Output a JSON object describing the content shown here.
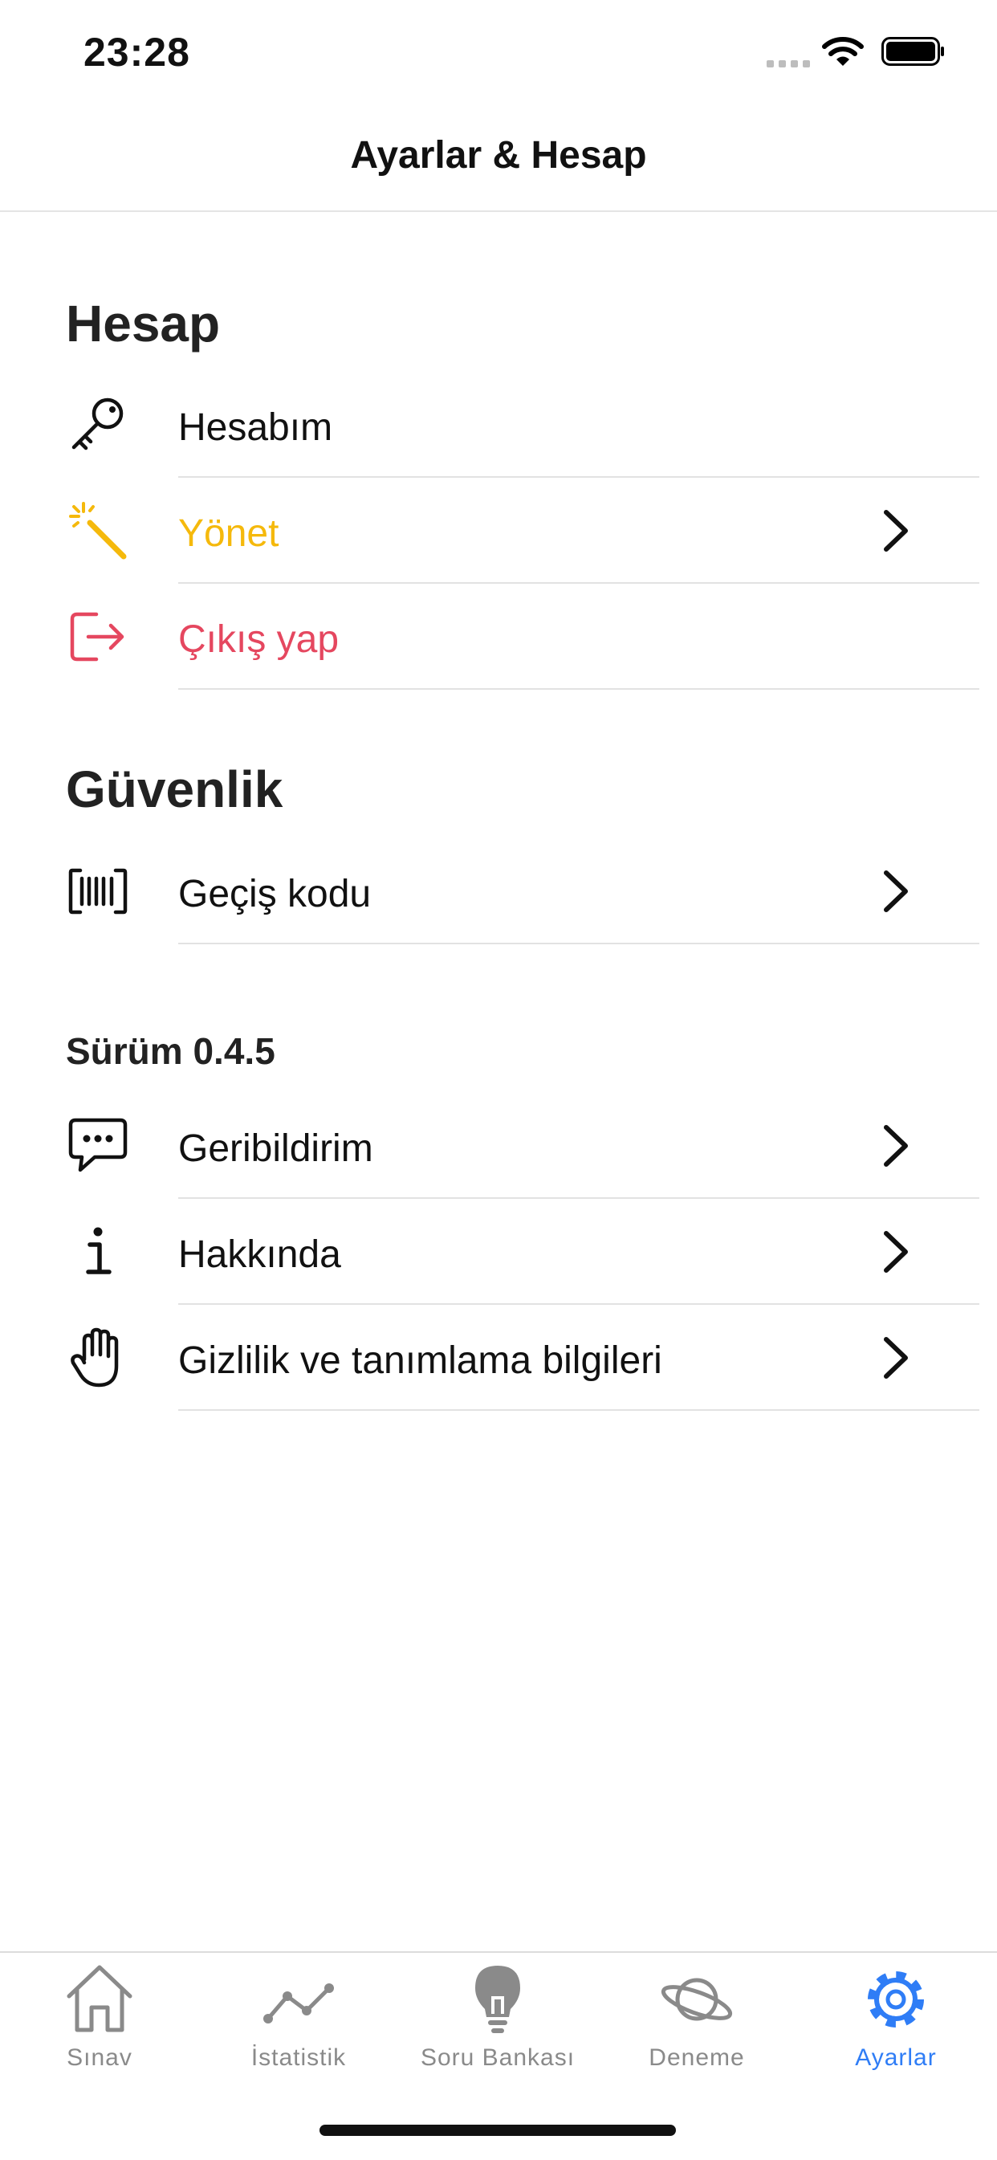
{
  "status_bar": {
    "time": "23:28"
  },
  "nav": {
    "title": "Ayarlar & Hesap"
  },
  "sections": {
    "hesap": {
      "title": "Hesap",
      "items": [
        {
          "label": "Hesabım",
          "icon": "key-icon"
        },
        {
          "label": "Yönet",
          "icon": "magic-wand-icon",
          "color": "#f5b90c"
        },
        {
          "label": "Çıkış yap",
          "icon": "sign-out-icon",
          "color": "#e5475f"
        }
      ]
    },
    "guvenlik": {
      "title": "Güvenlik",
      "items": [
        {
          "label": "Geçiş kodu",
          "icon": "barcode-icon"
        }
      ]
    },
    "surum": {
      "title": "Sürüm 0.4.5",
      "items": [
        {
          "label": "Geribildirim",
          "icon": "chat-icon"
        },
        {
          "label": "Hakkında",
          "icon": "info-icon"
        },
        {
          "label": "Gizlilik ve tanımlama bilgileri",
          "icon": "hand-icon"
        }
      ]
    }
  },
  "tabs": [
    {
      "label": "Sınav",
      "icon": "home-icon"
    },
    {
      "label": "İstatistik",
      "icon": "chart-icon"
    },
    {
      "label": "Soru Bankası",
      "icon": "lightbulb-icon"
    },
    {
      "label": "Deneme",
      "icon": "planet-icon"
    },
    {
      "label": "Ayarlar",
      "icon": "gear-icon",
      "active": true
    }
  ],
  "colors": {
    "accent": "#2f7df6",
    "warning": "#f5b90c",
    "danger": "#e5475f",
    "inactive": "#8a8a8a"
  }
}
